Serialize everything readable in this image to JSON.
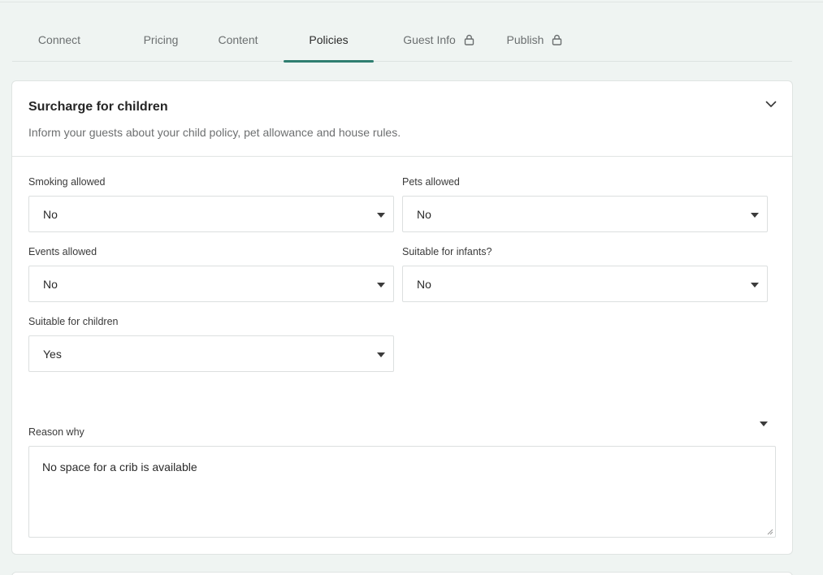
{
  "tabs": [
    {
      "label": "Connect",
      "active": false,
      "locked": false
    },
    {
      "label": "Pricing",
      "active": false,
      "locked": false
    },
    {
      "label": "Content",
      "active": false,
      "locked": false
    },
    {
      "label": "Policies",
      "active": true,
      "locked": false
    },
    {
      "label": "Guest Info",
      "active": false,
      "locked": true
    },
    {
      "label": "Publish",
      "active": false,
      "locked": true
    }
  ],
  "card": {
    "title": "Surcharge for children",
    "subtitle": "Inform your guests about your child policy, pet allowance and house rules."
  },
  "fields": {
    "smoking": {
      "label": "Smoking allowed",
      "value": "No"
    },
    "pets": {
      "label": "Pets allowed",
      "value": "No"
    },
    "events": {
      "label": "Events allowed",
      "value": "No"
    },
    "infants": {
      "label": "Suitable for infants?",
      "value": "No"
    },
    "children": {
      "label": "Suitable for children",
      "value": "Yes"
    },
    "reason": {
      "label": "Reason why",
      "value": "No space for a crib is available"
    }
  },
  "colors": {
    "accent": "#2f7e70",
    "background": "#eff4f2"
  }
}
